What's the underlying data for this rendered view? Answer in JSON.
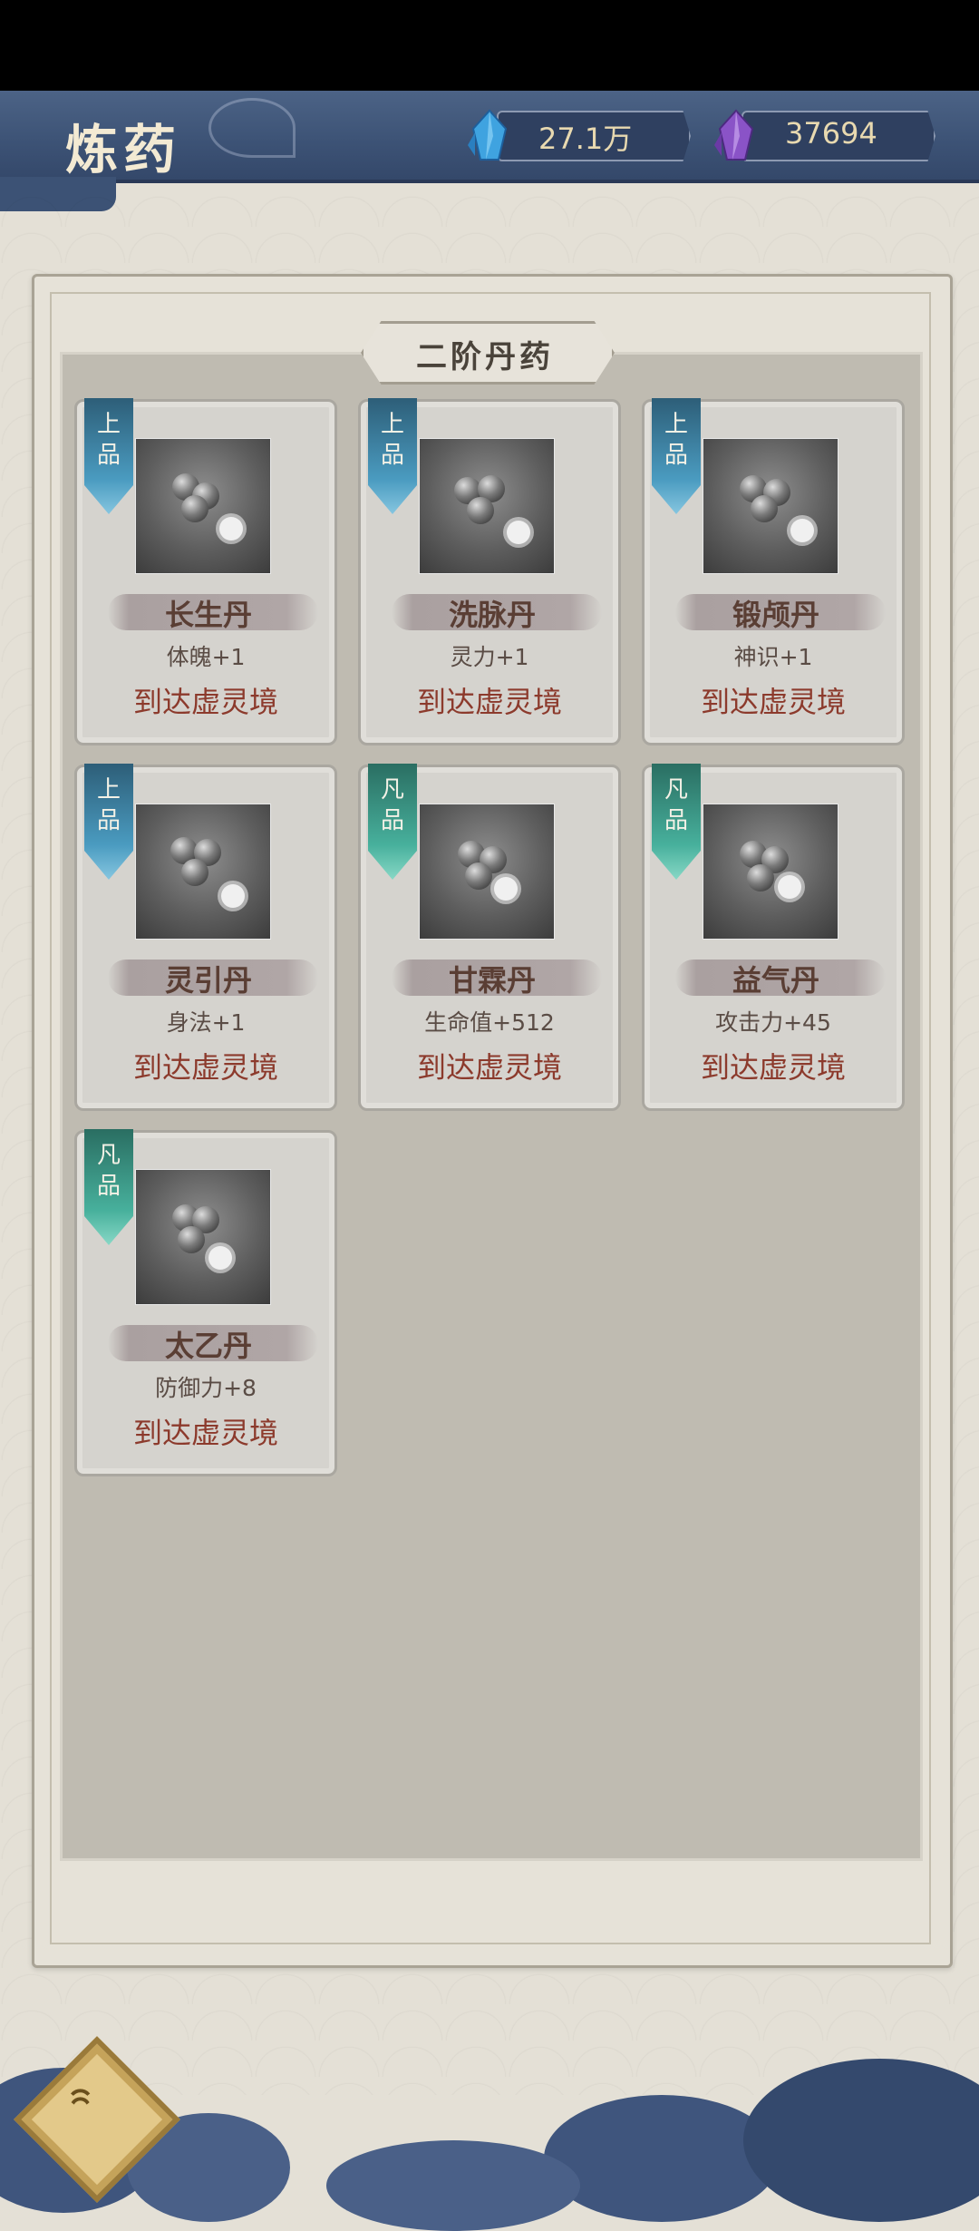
{
  "header": {
    "title": "炼药",
    "resources": [
      {
        "icon": "blue-crystal-icon",
        "value": "27.1万"
      },
      {
        "icon": "purple-crystal-icon",
        "value": "37694"
      }
    ]
  },
  "section": {
    "title": "二阶丹药"
  },
  "pills": [
    {
      "rank": "上\n品",
      "rank_type": "upper",
      "name": "长生丹",
      "effect": "体魄+1",
      "requirement": "到达虚灵境"
    },
    {
      "rank": "上\n品",
      "rank_type": "upper",
      "name": "洗脉丹",
      "effect": "灵力+1",
      "requirement": "到达虚灵境"
    },
    {
      "rank": "上\n品",
      "rank_type": "upper",
      "name": "锻颅丹",
      "effect": "神识+1",
      "requirement": "到达虚灵境"
    },
    {
      "rank": "上\n品",
      "rank_type": "upper",
      "name": "灵引丹",
      "effect": "身法+1",
      "requirement": "到达虚灵境"
    },
    {
      "rank": "凡\n品",
      "rank_type": "common",
      "name": "甘霖丹",
      "effect": "生命值+512",
      "requirement": "到达虚灵境"
    },
    {
      "rank": "凡\n品",
      "rank_type": "common",
      "name": "益气丹",
      "effect": "攻击力+45",
      "requirement": "到达虚灵境"
    },
    {
      "rank": "凡\n品",
      "rank_type": "common",
      "name": "太乙丹",
      "effect": "防御力+8",
      "requirement": "到达虚灵境"
    }
  ],
  "bottom": {
    "menu_icon": "swirl-menu-icon"
  },
  "colors": {
    "header_bg": "#3c5275",
    "requirement_text": "#8c3a2c",
    "rank_upper": "#4a9bc0",
    "rank_common": "#47b09c"
  }
}
